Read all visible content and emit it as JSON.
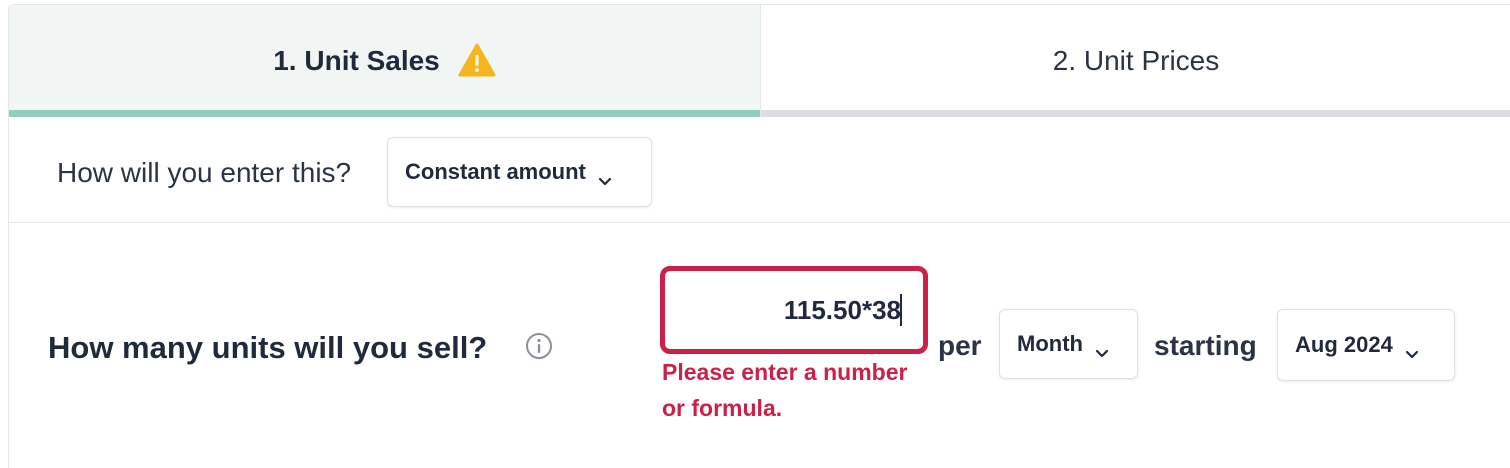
{
  "tabs": [
    {
      "label": "1. Unit Sales",
      "active": true,
      "warning_icon": "warning-triangle-icon"
    },
    {
      "label": "2. Unit Prices",
      "active": false
    }
  ],
  "entry_method": {
    "question": "How will you enter this?",
    "selected": "Constant amount"
  },
  "units": {
    "question": "How many units will you sell?",
    "info_icon": "info-circle-icon",
    "input_value": "115.50*38",
    "error": "Please enter a number or formula.",
    "per_label": "per",
    "period": "Month",
    "starting_label": "starting",
    "start_date": "Aug 2024"
  },
  "colors": {
    "active_tab_bg": "#f1f6f4",
    "active_tab_underline": "#8fcfbe",
    "inactive_tab_underline": "#dcdce2",
    "warning": "#f7b51c",
    "error": "#cc1f4a",
    "text": "#1f2b3d"
  }
}
